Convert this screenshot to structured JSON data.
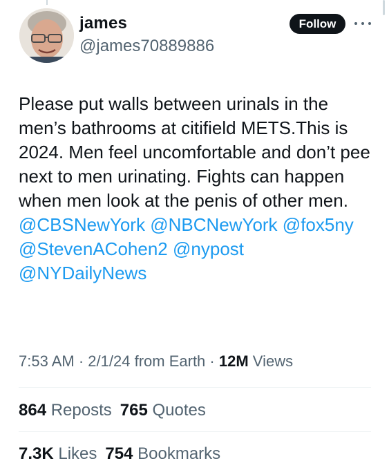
{
  "user": {
    "display_name": "james",
    "handle": "@james70889886"
  },
  "follow_label": "Follow",
  "tweet": {
    "line1": "Please put walls between urinals in the men’s bathrooms at citifield METS.This is 2024. Men feel uncomfortable and don’t pee next to men urinating. Fights can happen when men look at the penis of other men.",
    "mentions": [
      "@CBSNewYork",
      "@NBCNewYork",
      "@fox5ny",
      "@StevenACohen2",
      "@nypost",
      "@NYDailyNews"
    ]
  },
  "meta": {
    "time": "7:53 AM",
    "date": "2/1/24",
    "source": "from Earth",
    "views_count": "12M",
    "views_label": "Views",
    "separator": "·"
  },
  "stats": {
    "reposts_count": "864",
    "reposts_label": "Reposts",
    "quotes_count": "765",
    "quotes_label": "Quotes",
    "likes_count": "7.3K",
    "likes_label": "Likes",
    "bookmarks_count": "754",
    "bookmarks_label": "Bookmarks"
  },
  "colors": {
    "text": "#0f1419",
    "secondary": "#536471",
    "link": "#1d9bf0",
    "divider": "#eff3f4",
    "button_bg": "#0f1419"
  }
}
